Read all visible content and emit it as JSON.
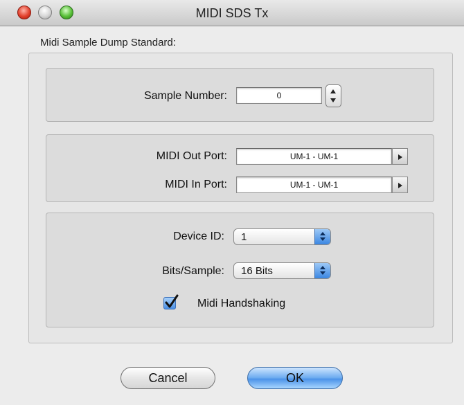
{
  "window": {
    "title": "MIDI SDS Tx"
  },
  "group": {
    "label": "Midi Sample Dump Standard:"
  },
  "sample": {
    "label": "Sample Number:",
    "value": "0"
  },
  "ports": {
    "out_label": "MIDI Out Port:",
    "out_value": "UM-1 - UM-1",
    "in_label": "MIDI In Port:",
    "in_value": "UM-1 - UM-1"
  },
  "device": {
    "id_label": "Device ID:",
    "id_value": "1",
    "bits_label": "Bits/Sample:",
    "bits_value": "16 Bits",
    "handshake_label": "Midi Handshaking",
    "handshake_checked": true
  },
  "buttons": {
    "cancel": "Cancel",
    "ok": "OK"
  },
  "colors": {
    "accent": "#4b92e8",
    "close": "#e2402c",
    "zoom": "#58bf38"
  }
}
